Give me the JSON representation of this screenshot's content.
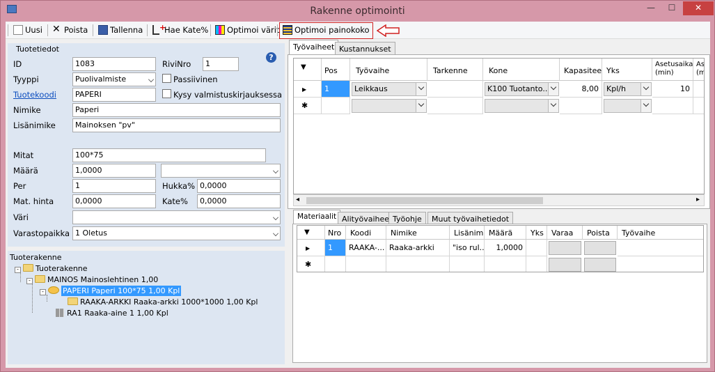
{
  "window": {
    "title": "Rakenne optimointi",
    "min": "—",
    "max": "☐",
    "close": "✕"
  },
  "toolbar": {
    "uusi": "Uusi",
    "poista": "Poista",
    "tallenna": "Tallenna",
    "hae_kate": "Hae Kate%",
    "optimoi_varit": "Optimoi värit",
    "optimoi_painokoko": "Optimoi painokoko"
  },
  "tuotetiedot": {
    "title": "Tuotetiedot",
    "id_label": "ID",
    "id_value": "1083",
    "rivinro_label": "RiviNro",
    "rivinro_value": "1",
    "tyyppi_label": "Tyyppi",
    "tyyppi_value": "Puolivalmiste",
    "passiivinen_label": "Passiivinen",
    "tuotekoodi_label": "Tuotekoodi",
    "tuotekoodi_value": "PAPERI",
    "kysy_label": "Kysy valmistuskirjauksessa",
    "nimike_label": "Nimike",
    "nimike_value": "Paperi",
    "lisanimike_label": "Lisänimike",
    "lisanimike_value": "Mainoksen \"pv\"",
    "mitat_label": "Mitat",
    "mitat_value": "100*75",
    "maara_label": "Määrä",
    "maara_value": "1,0000",
    "per_label": "Per",
    "per_value": "1",
    "hukka_label": "Hukka%",
    "hukka_value": "0,0000",
    "mathinta_label": "Mat. hinta",
    "mathinta_value": "0,0000",
    "kate_label": "Kate%",
    "kate_value": "0,0000",
    "vari_label": "Väri",
    "varasto_label": "Varastopaikka",
    "varasto_value": "1 Oletus",
    "help": "?"
  },
  "tuoterakenne": {
    "title": "Tuoterakenne",
    "nodes": [
      "Tuoterakenne",
      "MAINOS  Mainoslehtinen  1,00",
      "PAPERI  Paperi 100*75  1,00 Kpl",
      "RAAKA-ARKKI  Raaka-arkki 1000*1000  1,00 Kpl",
      "RA1  Raaka-aine 1   1,00 Kpl"
    ]
  },
  "top_tabs": [
    "Työvaiheet",
    "Kustannukset"
  ],
  "tyovaiheet": {
    "headers": [
      "Pos",
      "Työvaihe",
      "Tarkenne",
      "Kone",
      "Kapasiteetti",
      "Yks",
      "Asetusaika (min)",
      "Ase (min"
    ],
    "row": {
      "pos": "1",
      "tyovaihe": "Leikkaus",
      "tarkenne": "",
      "kone": "K100 Tuotanto...",
      "kapasiteetti": "8,00",
      "yks": "Kpl/h",
      "asetusaika": "10"
    }
  },
  "bottom_tabs": [
    "Materiaalit",
    "Alityövaiheet",
    "Työohje",
    "Muut työvaihetiedot"
  ],
  "materiaalit": {
    "headers": [
      "Nro",
      "Koodi",
      "Nimike",
      "Lisänimike",
      "Määrä",
      "Yks",
      "Varaa",
      "Poista",
      "Työvaihe"
    ],
    "row": {
      "nro": "1",
      "koodi": "RAAKA-...",
      "nimike": "Raaka-arkki",
      "lisanimike": "\"iso rul...",
      "maara": "1,0000",
      "yks": ""
    }
  },
  "grid_glyphs": {
    "sort": "▼",
    "current": "▶",
    "new": "✱"
  },
  "scroll": {
    "right": "▸",
    "left": "◂"
  }
}
